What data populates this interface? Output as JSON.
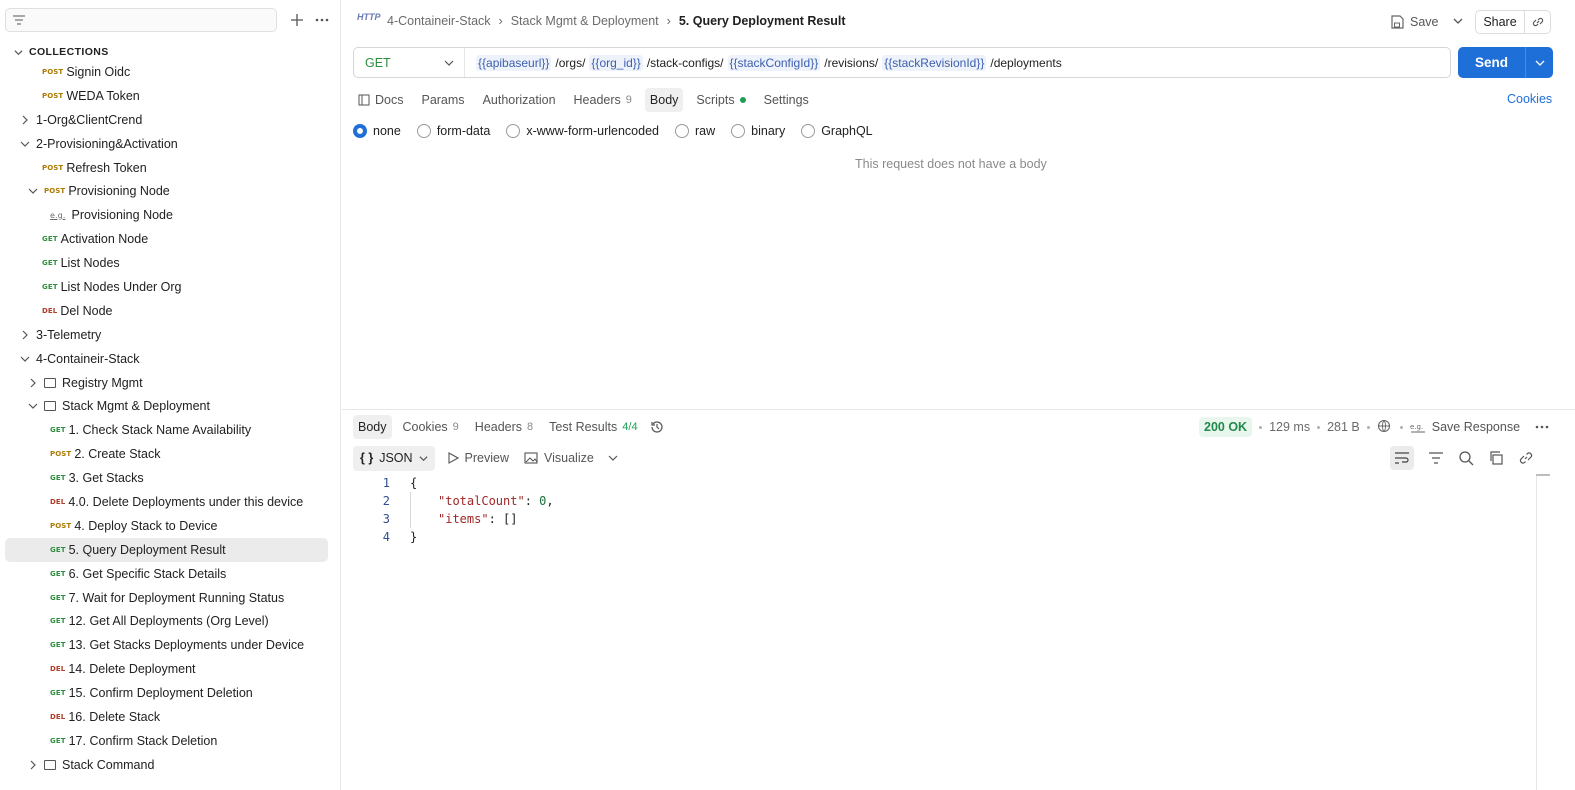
{
  "sidebar": {
    "collections_label": "COLLECTIONS",
    "items": [
      {
        "indent": 42,
        "chevron": "",
        "badge": "POST",
        "label": "Signin Oidc"
      },
      {
        "indent": 42,
        "chevron": "",
        "badge": "POST",
        "label": "WEDA Token"
      },
      {
        "indent": 20,
        "chevron": "right",
        "badge": "",
        "label": "1-Org&ClientCrend"
      },
      {
        "indent": 20,
        "chevron": "down",
        "badge": "",
        "label": "2-Provisioning&Activation"
      },
      {
        "indent": 42,
        "chevron": "",
        "badge": "POST",
        "label": "Refresh Token"
      },
      {
        "indent": 28,
        "chevron": "down",
        "badge": "POST",
        "label": "Provisioning Node"
      },
      {
        "indent": 50,
        "chevron": "",
        "badge": "e.g.",
        "label": "Provisioning Node"
      },
      {
        "indent": 42,
        "chevron": "",
        "badge": "GET",
        "label": "Activation Node"
      },
      {
        "indent": 42,
        "chevron": "",
        "badge": "GET",
        "label": "List Nodes"
      },
      {
        "indent": 42,
        "chevron": "",
        "badge": "GET",
        "label": "List Nodes Under Org"
      },
      {
        "indent": 42,
        "chevron": "",
        "badge": "DEL",
        "label": "Del Node"
      },
      {
        "indent": 20,
        "chevron": "right",
        "badge": "",
        "label": "3-Telemetry"
      },
      {
        "indent": 20,
        "chevron": "down",
        "badge": "",
        "label": "4-Containeir-Stack"
      },
      {
        "indent": 28,
        "chevron": "right",
        "badge": "folder",
        "label": "Registry Mgmt"
      },
      {
        "indent": 28,
        "chevron": "down",
        "badge": "folder",
        "label": "Stack Mgmt & Deployment"
      },
      {
        "indent": 50,
        "chevron": "",
        "badge": "GET",
        "label": "1. Check Stack Name Availability"
      },
      {
        "indent": 50,
        "chevron": "",
        "badge": "POST",
        "label": "2. Create Stack"
      },
      {
        "indent": 50,
        "chevron": "",
        "badge": "GET",
        "label": "3. Get Stacks"
      },
      {
        "indent": 50,
        "chevron": "",
        "badge": "DEL",
        "label": "4.0. Delete Deployments under this device"
      },
      {
        "indent": 50,
        "chevron": "",
        "badge": "POST",
        "label": "4. Deploy Stack to Device"
      },
      {
        "indent": 50,
        "chevron": "",
        "badge": "GET",
        "label": "5. Query Deployment Result",
        "selected": true
      },
      {
        "indent": 50,
        "chevron": "",
        "badge": "GET",
        "label": "6. Get Specific Stack Details"
      },
      {
        "indent": 50,
        "chevron": "",
        "badge": "GET",
        "label": "7. Wait for Deployment Running Status"
      },
      {
        "indent": 50,
        "chevron": "",
        "badge": "GET",
        "label": "12. Get All Deployments (Org Level)"
      },
      {
        "indent": 50,
        "chevron": "",
        "badge": "GET",
        "label": "13. Get Stacks Deployments under Device"
      },
      {
        "indent": 50,
        "chevron": "",
        "badge": "DEL",
        "label": "14. Delete Deployment"
      },
      {
        "indent": 50,
        "chevron": "",
        "badge": "GET",
        "label": "15. Confirm Deployment Deletion"
      },
      {
        "indent": 50,
        "chevron": "",
        "badge": "DEL",
        "label": "16. Delete Stack"
      },
      {
        "indent": 50,
        "chevron": "",
        "badge": "GET",
        "label": "17. Confirm Stack Deletion"
      },
      {
        "indent": 28,
        "chevron": "right",
        "badge": "folder",
        "label": "Stack Command"
      }
    ]
  },
  "header": {
    "http_icon": "HTTP",
    "crumbs": [
      "4-Containeir-Stack",
      "Stack Mgmt & Deployment",
      "5. Query Deployment Result"
    ],
    "save_label": "Save",
    "share_label": "Share"
  },
  "request": {
    "method": "GET",
    "url_parts": [
      {
        "text": "{{apibaseurl}}",
        "var": true
      },
      {
        "text": "/orgs/",
        "var": false
      },
      {
        "text": "{{org_id}}",
        "var": true
      },
      {
        "text": "/stack-configs/",
        "var": false
      },
      {
        "text": "{{stackConfigId}}",
        "var": true
      },
      {
        "text": "/revisions/",
        "var": false
      },
      {
        "text": "{{stackRevisionId}}",
        "var": true
      },
      {
        "text": "/deployments",
        "var": false
      }
    ],
    "send_label": "Send",
    "tabs": [
      {
        "label": "Docs",
        "count": ""
      },
      {
        "label": "Params",
        "count": ""
      },
      {
        "label": "Authorization",
        "count": ""
      },
      {
        "label": "Headers",
        "count": "9"
      },
      {
        "label": "Body",
        "count": "",
        "active": true
      },
      {
        "label": "Scripts",
        "count": "",
        "dot": true
      },
      {
        "label": "Settings",
        "count": ""
      }
    ],
    "cookies_label": "Cookies",
    "body_types": [
      "none",
      "form-data",
      "x-www-form-urlencoded",
      "raw",
      "binary",
      "GraphQL"
    ],
    "body_selected": "none",
    "no_body_text": "This request does not have a body"
  },
  "response": {
    "tabs": [
      {
        "label": "Body",
        "count": "",
        "active": true
      },
      {
        "label": "Cookies",
        "count": "9"
      },
      {
        "label": "Headers",
        "count": "8"
      },
      {
        "label": "Test Results",
        "count": "4/4"
      }
    ],
    "status": "200 OK",
    "time": "129 ms",
    "size": "281 B",
    "save_response": "Save Response",
    "format": "JSON",
    "preview": "Preview",
    "visualize": "Visualize",
    "code_lines": [
      {
        "num": "1",
        "text": "{"
      },
      {
        "num": "2",
        "key": "\"totalCount\"",
        "value": "0",
        "trail": ","
      },
      {
        "num": "3",
        "key": "\"items\"",
        "value": "[]",
        "trail": ""
      },
      {
        "num": "4",
        "text": "}"
      }
    ]
  },
  "colors": {
    "accent": "#1f6fd8",
    "get": "#2f8f3f",
    "post": "#ad7a03",
    "del": "#b03c2a",
    "ok": "#1f8a4c"
  }
}
